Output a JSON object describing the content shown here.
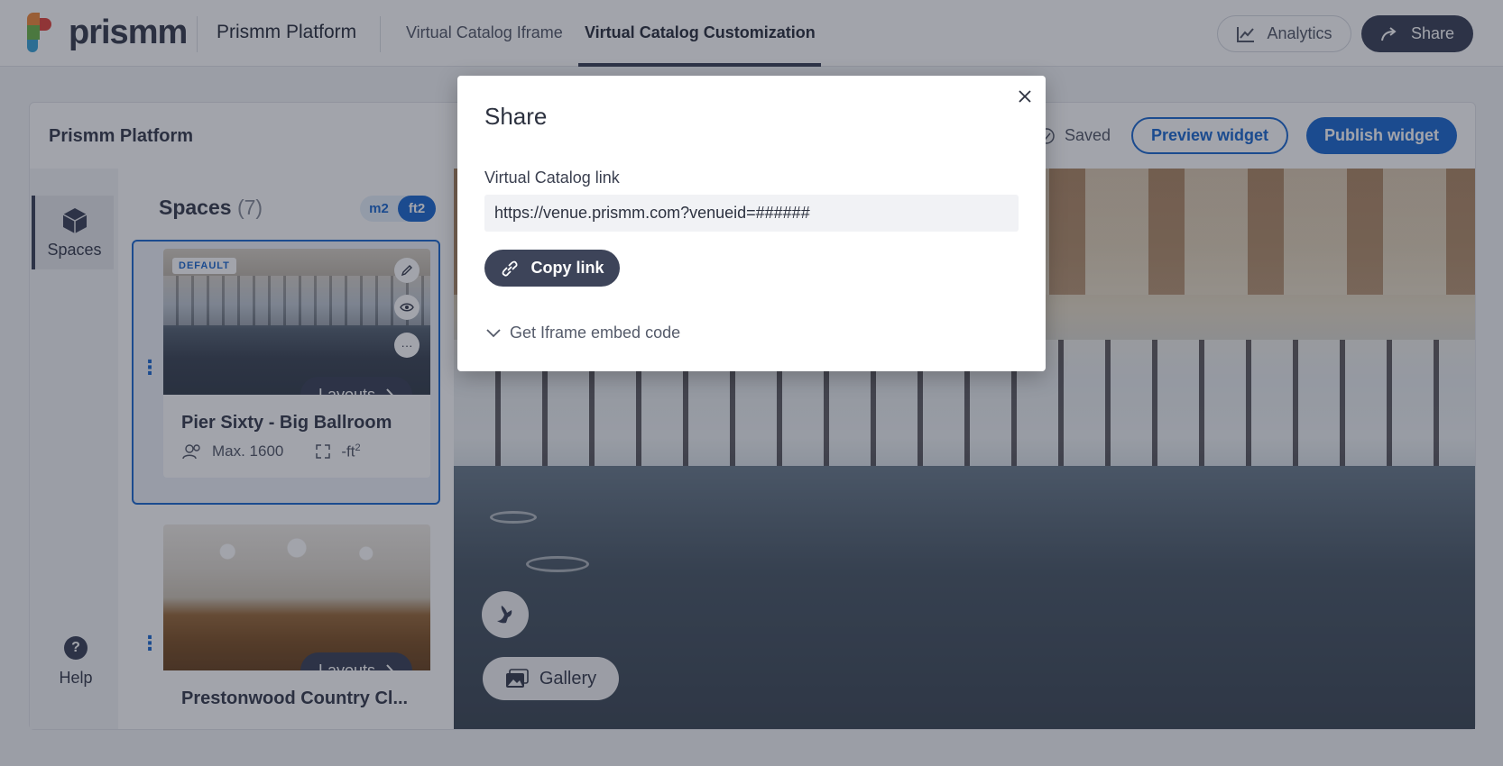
{
  "topbar": {
    "brand": "prismm",
    "platform_title": "Prismm Platform",
    "tabs": [
      {
        "label": "Virtual Catalog Iframe",
        "active": false
      },
      {
        "label": "Virtual Catalog Customization",
        "active": true
      }
    ],
    "analytics_label": "Analytics",
    "share_label": "Share",
    "icons": {
      "analytics": "chart-line-icon",
      "share": "share-arrow-icon"
    }
  },
  "card": {
    "title": "Prismm Platform",
    "saved_label": "Saved",
    "preview_label": "Preview widget",
    "publish_label": "Publish widget"
  },
  "rail": {
    "spaces_label": "Spaces",
    "help_label": "Help"
  },
  "spaces": {
    "title": "Spaces",
    "count": "(7)",
    "units": [
      "m2",
      "ft2"
    ],
    "selected_unit": "ft2",
    "items": [
      {
        "name": "Pier Sixty - Big Ballroom",
        "badge": "DEFAULT",
        "capacity": "Max. 1600",
        "area": "-ft",
        "area_sup": "2",
        "layouts_label": "Layouts"
      },
      {
        "name": "Prestonwood Country Cl...",
        "layouts_label": "Layouts"
      }
    ]
  },
  "viewer": {
    "gallery_label": "Gallery"
  },
  "modal": {
    "title": "Share",
    "link_label": "Virtual Catalog link",
    "link_value": "https://venue.prismm.com?venueid=######",
    "copy_label": "Copy link",
    "embed_label": "Get Iframe embed code"
  },
  "colors": {
    "accent": "#1f6bd1",
    "dark": "#3d4459"
  }
}
